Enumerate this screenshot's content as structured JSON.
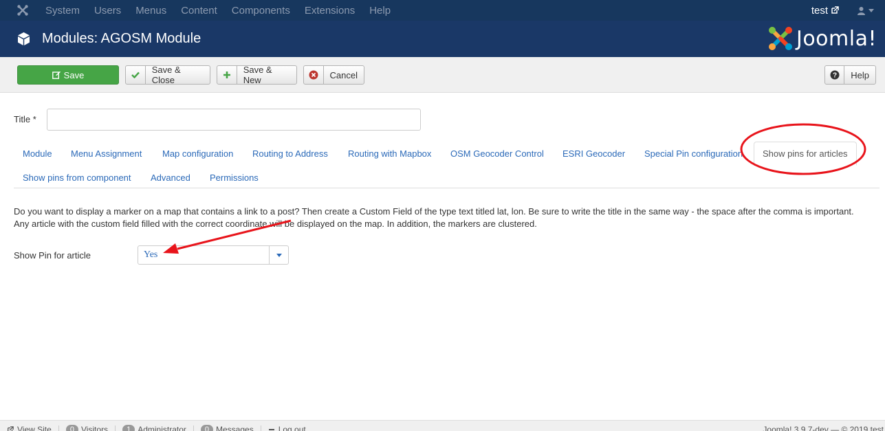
{
  "topnav": {
    "menu": [
      "System",
      "Users",
      "Menus",
      "Content",
      "Components",
      "Extensions",
      "Help"
    ],
    "user_link": "test"
  },
  "header": {
    "title": "Modules: AGOSM Module",
    "logo_text": "Joomla!"
  },
  "toolbar": {
    "save": "Save",
    "save_close": "Save & Close",
    "save_new": "Save & New",
    "cancel": "Cancel",
    "help": "Help"
  },
  "form": {
    "title_label": "Title *",
    "title_value": ""
  },
  "tabs": [
    "Module",
    "Menu Assignment",
    "Map configuration",
    "Routing to Address",
    "Routing with Mapbox",
    "OSM Geocoder Control",
    "ESRI Geocoder",
    "Special Pin configuration",
    "Show pins for articles",
    "Show pins from component",
    "Advanced",
    "Permissions"
  ],
  "active_tab": "Show pins for articles",
  "description_line1": "Do you want to display a marker on a map that contains a link to a post? Then create a Custom Field of the type text titled lat, lon. Be sure to write the title in the same way - the space after the comma is important.",
  "description_line2": "Any article with the custom field filled with the correct coordinate will be displayed on the map. In addition, the markers are clustered.",
  "field": {
    "label": "Show Pin for article",
    "value": "Yes"
  },
  "statusbar": {
    "view_site": "View Site",
    "visitors_count": "0",
    "visitors": "Visitors",
    "admin_count": "1",
    "admin": "Administrator",
    "messages_count": "0",
    "messages": "Messages",
    "logout": "Log out",
    "version": "Joomla! 3.9.7-dev — © 2019 test"
  },
  "colors": {
    "nav_bg": "#17375e",
    "header_bg": "#1a3867",
    "save_green": "#46a546",
    "link_blue": "#2a69b8",
    "annotation_red": "#e8141b"
  }
}
